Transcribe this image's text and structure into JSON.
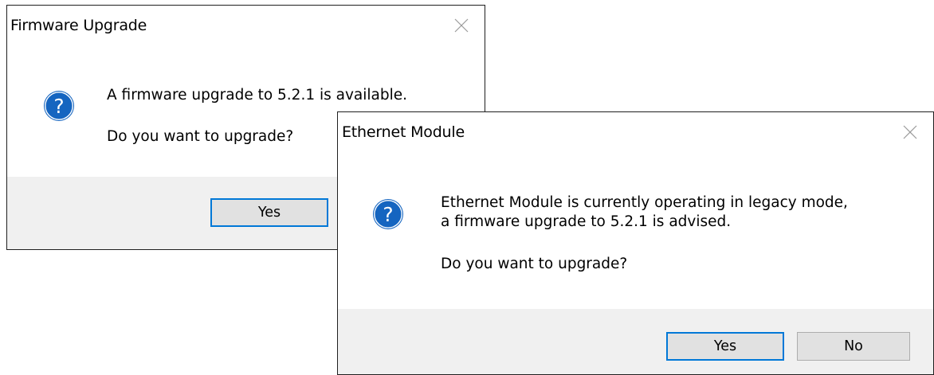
{
  "firmware_dialog": {
    "title": "Firmware Upgrade",
    "icon": "question-icon",
    "message_line1": "A firmware upgrade to 5.2.1 is available.",
    "message_line2": "Do you want to upgrade?",
    "yes_label": "Yes"
  },
  "ethernet_dialog": {
    "title": "Ethernet Module",
    "icon": "question-icon",
    "message_line1": "Ethernet Module is currently operating in legacy mode,",
    "message_line2": "a firmware upgrade to 5.2.1 is advised.",
    "message_line3": "Do you want to upgrade?",
    "yes_label": "Yes",
    "no_label": "No"
  },
  "colors": {
    "icon_blue": "#1565c0",
    "default_button_border": "#0078d7",
    "footer_bg": "#f0f0f0",
    "button_bg": "#e1e1e1"
  }
}
